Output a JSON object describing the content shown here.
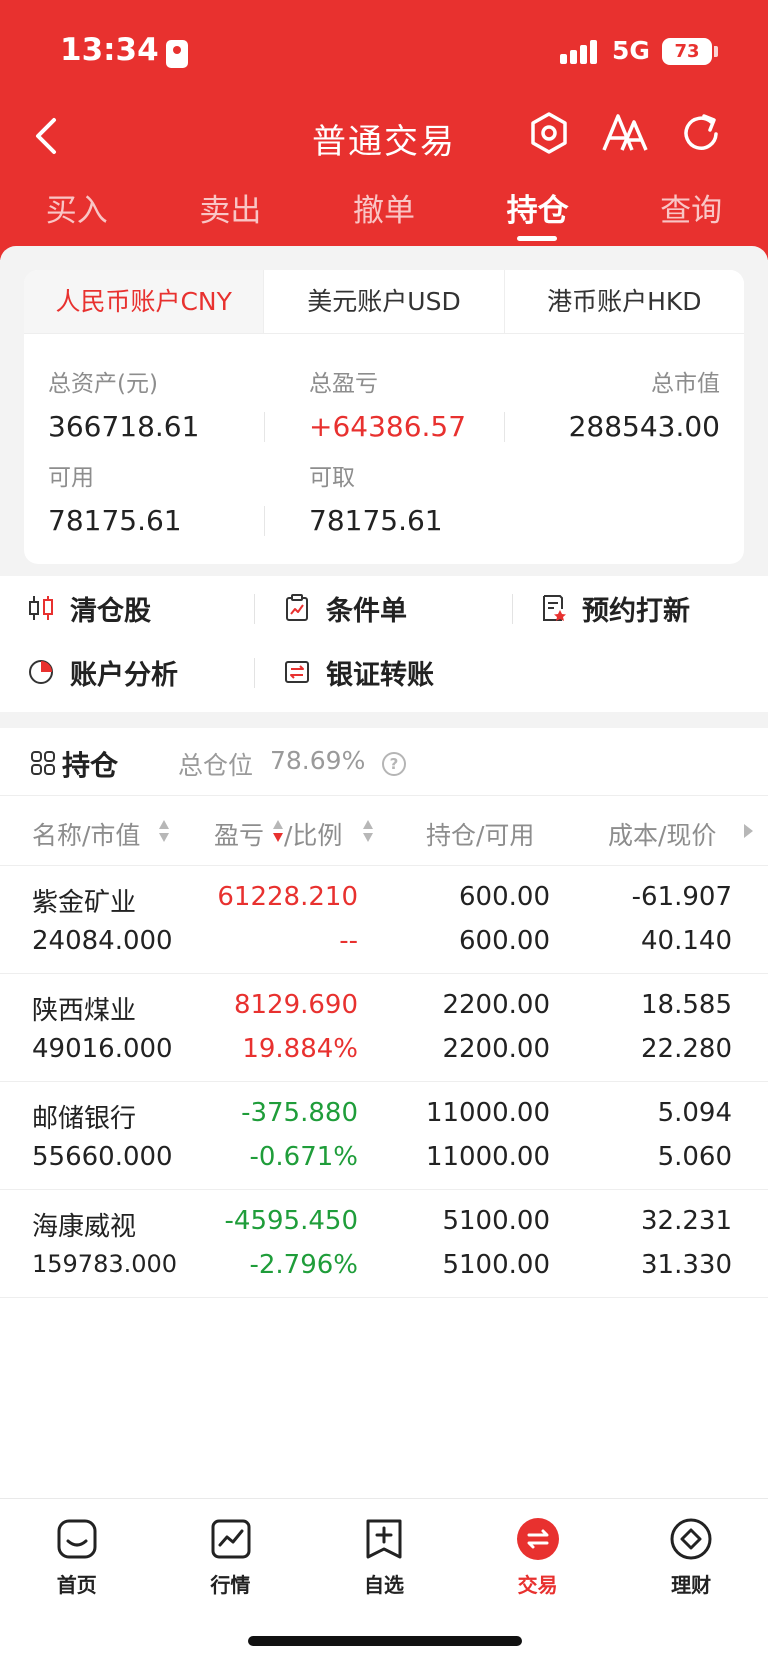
{
  "status": {
    "time": "13:34",
    "network": "5G",
    "battery": "73"
  },
  "nav": {
    "title": "普通交易"
  },
  "top_tabs": [
    {
      "label": "买入"
    },
    {
      "label": "卖出"
    },
    {
      "label": "撤单"
    },
    {
      "label": "持仓",
      "active": true
    },
    {
      "label": "查询"
    }
  ],
  "account_tabs": [
    {
      "label": "人民币账户CNY",
      "active": true
    },
    {
      "label": "美元账户USD"
    },
    {
      "label": "港币账户HKD"
    }
  ],
  "summary": {
    "total_assets_label": "总资产(元)",
    "total_assets": "366718.61",
    "total_pnl_label": "总盈亏",
    "total_pnl": "+64386.57",
    "market_value_label": "总市值",
    "market_value": "288543.00",
    "available_label": "可用",
    "available": "78175.61",
    "withdrawable_label": "可取",
    "withdrawable": "78175.61"
  },
  "quick_actions": [
    {
      "label": "清仓股",
      "icon": "candlestick-icon"
    },
    {
      "label": "条件单",
      "icon": "clipboard-chart-icon"
    },
    {
      "label": "预约打新",
      "icon": "document-star-icon"
    },
    {
      "label": "账户分析",
      "icon": "pie-chart-icon"
    },
    {
      "label": "银证转账",
      "icon": "transfer-icon"
    }
  ],
  "positions": {
    "title": "持仓",
    "ratio_label": "总仓位",
    "ratio_value": "78.69%",
    "help_glyph": "?",
    "columns": {
      "name_mv": "名称/市值",
      "pnl": "盈亏",
      "ratio": "/比例",
      "hold_avail": "持仓/可用",
      "cost_price": "成本/现价"
    },
    "rows": [
      {
        "name": "紫金矿业",
        "market_value": "24084.000",
        "pnl": "61228.210",
        "pnl_ratio": "--",
        "hold": "600.00",
        "avail": "600.00",
        "cost": "-61.907",
        "price": "40.140",
        "trend": "up"
      },
      {
        "name": "陕西煤业",
        "market_value": "49016.000",
        "pnl": "8129.690",
        "pnl_ratio": "19.884%",
        "hold": "2200.00",
        "avail": "2200.00",
        "cost": "18.585",
        "price": "22.280",
        "trend": "up"
      },
      {
        "name": "邮储银行",
        "market_value": "55660.000",
        "pnl": "-375.880",
        "pnl_ratio": "-0.671%",
        "hold": "11000.00",
        "avail": "11000.00",
        "cost": "5.094",
        "price": "5.060",
        "trend": "down"
      },
      {
        "name": "海康威视",
        "market_value": "159783.000",
        "pnl": "-4595.450",
        "pnl_ratio": "-2.796%",
        "hold": "5100.00",
        "avail": "5100.00",
        "cost": "32.231",
        "price": "31.330",
        "trend": "down"
      }
    ]
  },
  "bottom_nav": [
    {
      "label": "首页",
      "icon": "home-icon"
    },
    {
      "label": "行情",
      "icon": "market-chart-icon"
    },
    {
      "label": "自选",
      "icon": "watchlist-add-icon"
    },
    {
      "label": "交易",
      "icon": "trade-icon",
      "active": true
    },
    {
      "label": "理财",
      "icon": "wealth-icon"
    }
  ],
  "colors": {
    "brand_red": "#e8312f",
    "up": "#e8312f",
    "down": "#1f9d3a"
  }
}
